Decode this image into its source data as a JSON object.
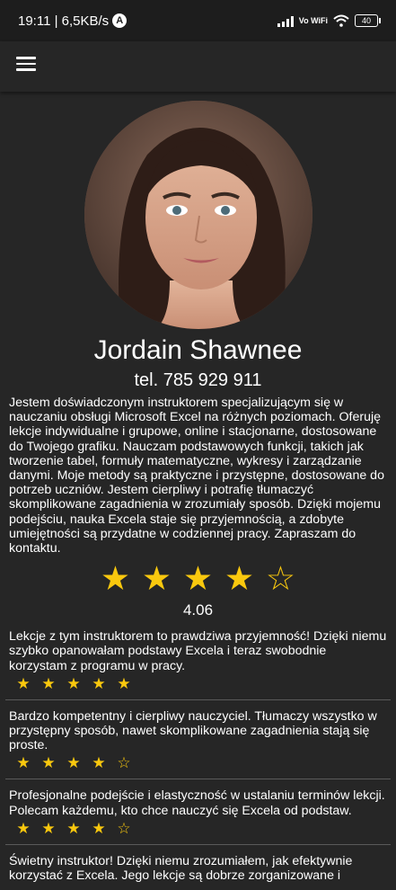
{
  "status_bar": {
    "time_speed": "19:11 | 6,5KB/s",
    "app_badge": "A",
    "vowifi": "Vo WiFi",
    "battery": "40"
  },
  "instructor": {
    "name": "Jordain Shawnee",
    "phone": "tel. 785 929 911",
    "bio": "Jestem doświadczonym instruktorem specjalizującym się w nauczaniu obsługi Microsoft Excel na różnych poziomach. Oferuję lekcje indywidualne i grupowe, online i stacjonarne, dostosowane do Twojego grafiku. Nauczam podstawowych funkcji, takich jak tworzenie tabel, formuły matematyczne, wykresy i zarządzanie danymi. Moje metody są praktyczne i przystępne, dostosowane do potrzeb uczniów. Jestem cierpliwy i potrafię tłumaczyć skomplikowane zagadnienia w zrozumiały sposób. Dzięki mojemu podejściu, nauka Excela staje się przyjemnością, a zdobyte umiejętności są przydatne w codziennej pracy. Zapraszam do kontaktu.",
    "rating_stars": [
      "★",
      "★",
      "★",
      "★",
      "☆"
    ],
    "rating_value": "4.06"
  },
  "reviews": [
    {
      "text": "Lekcje z tym instruktorem to prawdziwa przyjemność! Dzięki niemu szybko opanowałam podstawy Excela i teraz swobodnie korzystam z programu w pracy.",
      "stars": [
        "★",
        "★",
        "★",
        "★",
        "★"
      ]
    },
    {
      "text": "Bardzo kompetentny i cierpliwy nauczyciel. Tłumaczy wszystko w przystępny sposób, nawet skomplikowane zagadnienia stają się proste.",
      "stars": [
        "★",
        "★",
        "★",
        "★",
        "☆"
      ]
    },
    {
      "text": "Profesjonalne podejście i elastyczność w ustalaniu terminów lekcji. Polecam każdemu, kto chce nauczyć się Excela od podstaw.",
      "stars": [
        "★",
        "★",
        "★",
        "★",
        "☆"
      ]
    },
    {
      "text": "Świetny instruktor! Dzięki niemu zrozumiałem, jak efektywnie korzystać z Excela. Jego lekcje są dobrze zorganizowane i",
      "stars": []
    }
  ],
  "colors": {
    "background": "#262626",
    "status_bar": "#1d1d1d",
    "star": "#f9c80e",
    "divider": "#5a5a5a"
  },
  "icons": {
    "menu": "hamburger-menu-icon",
    "signal": "signal-strength-icon",
    "wifi": "wifi-icon",
    "battery": "battery-icon"
  }
}
